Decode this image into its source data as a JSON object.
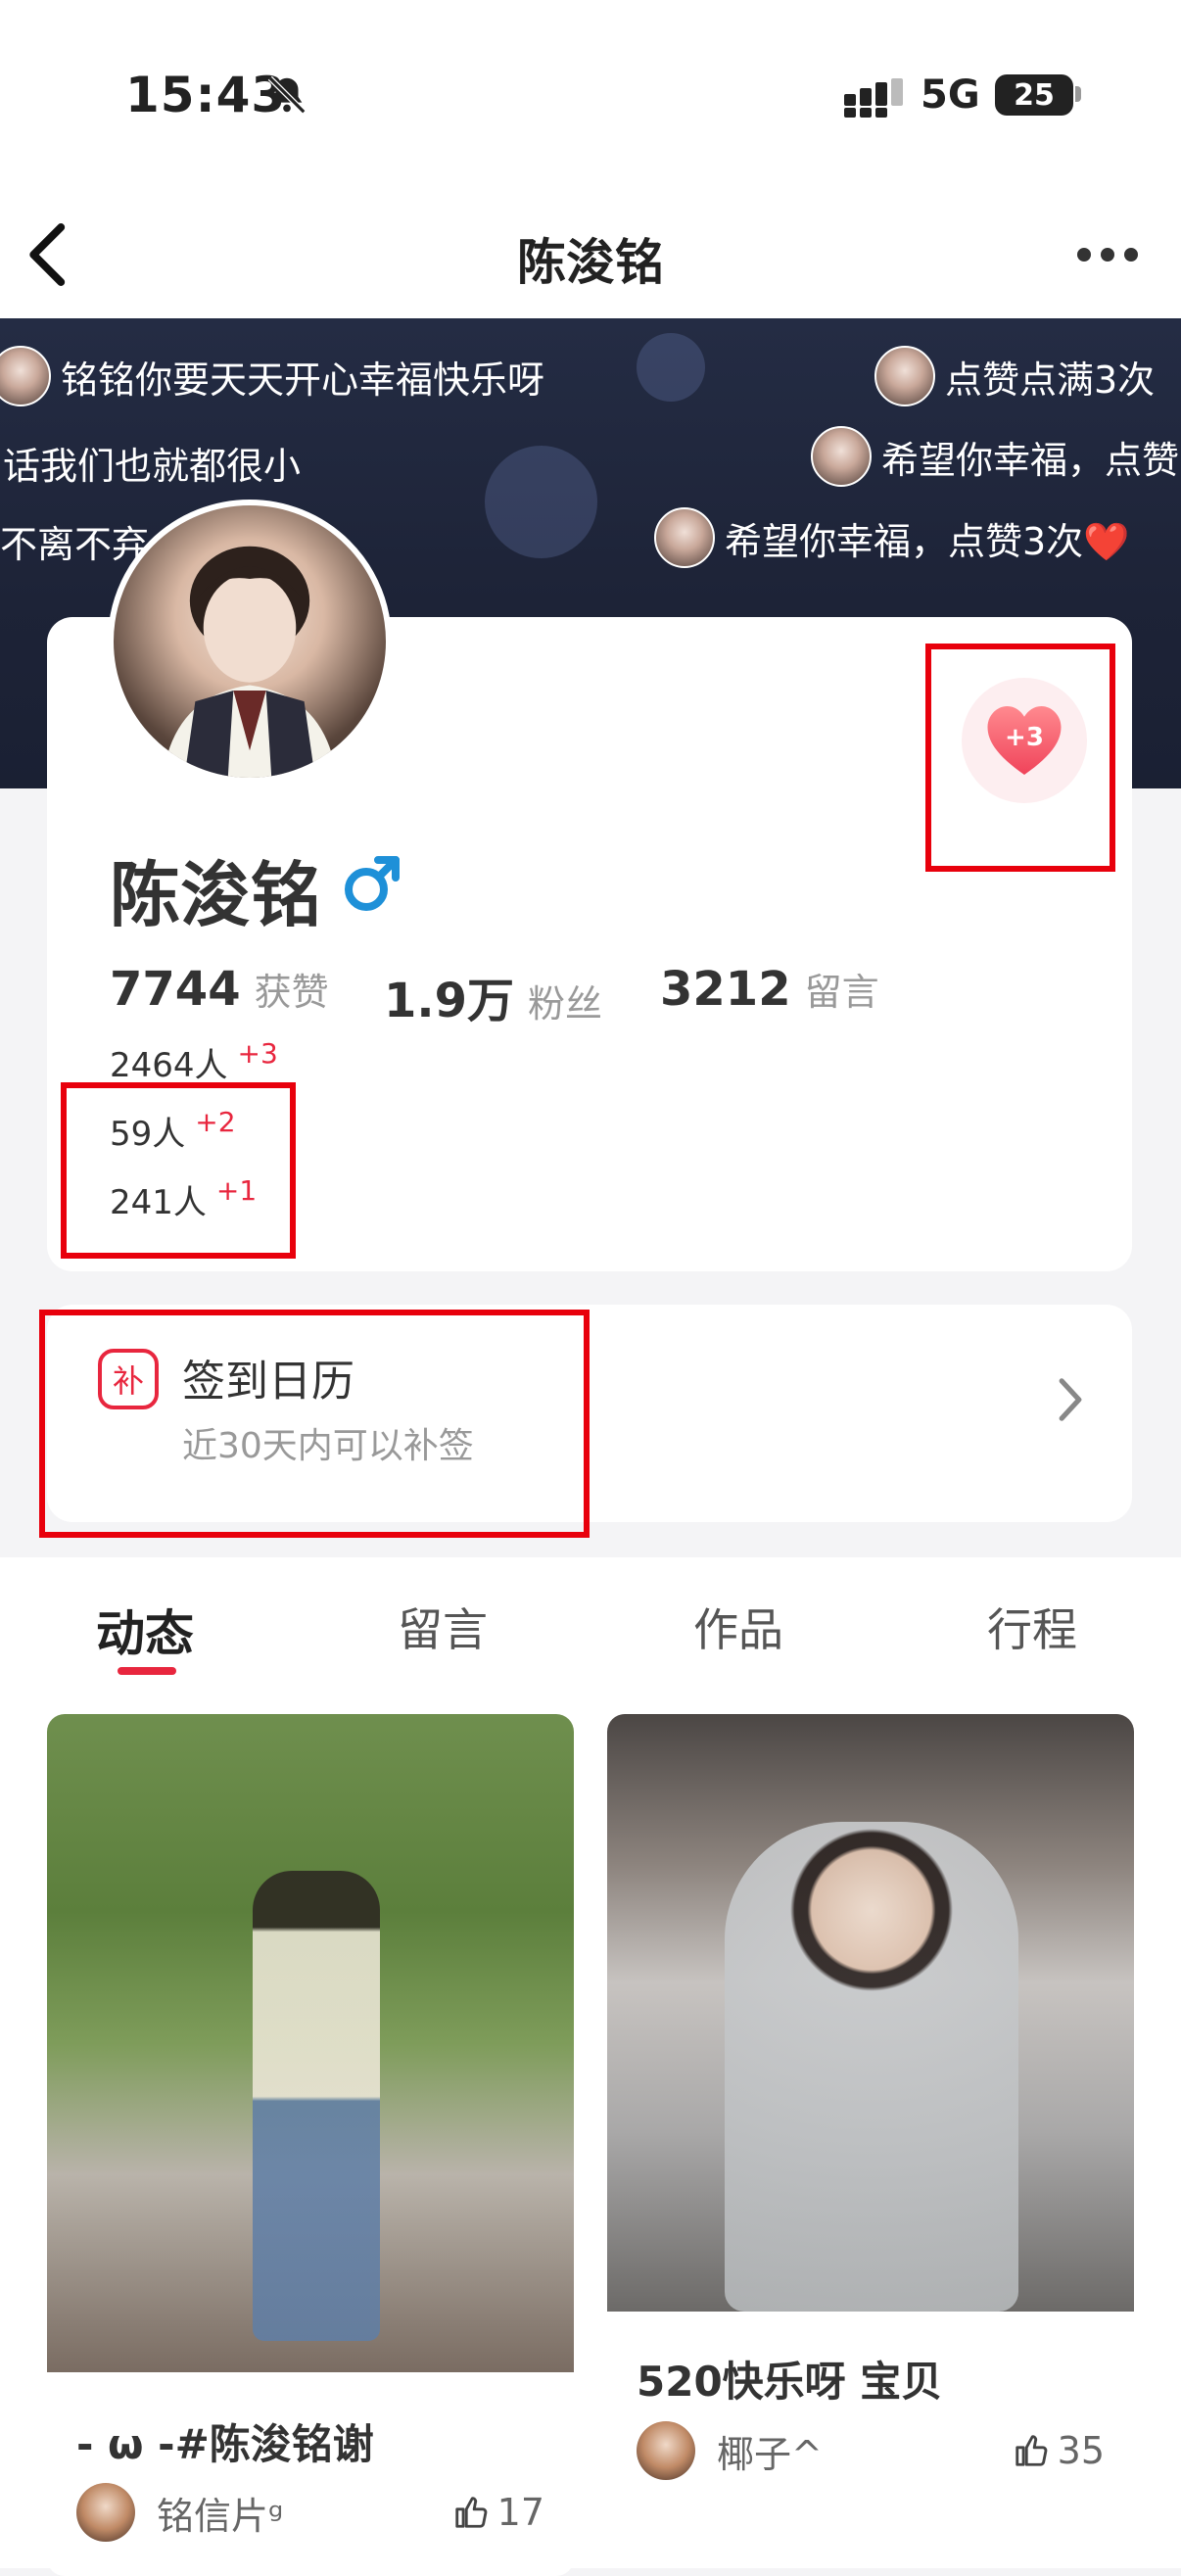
{
  "status": {
    "time": "15:43",
    "network": "5G",
    "battery": "25"
  },
  "nav": {
    "title": "陈浚铭"
  },
  "danmu": [
    "铭铭你要天天开心幸福快乐呀",
    "点赞点满3次",
    "话我们也就都很小",
    "希望你幸福，点赞",
    "不离不弃",
    "希望你幸福，点赞3次❤️"
  ],
  "profile": {
    "name": "陈浚铭",
    "like_plus": "+3",
    "stats": [
      {
        "value": "7744",
        "label": "获赞"
      },
      {
        "value": "1.9万",
        "label": "粉丝"
      },
      {
        "value": "3212",
        "label": "留言"
      }
    ],
    "counts": [
      {
        "text": "2464人",
        "inc": "+3"
      },
      {
        "text": "59人",
        "inc": "+2"
      },
      {
        "text": "241人",
        "inc": "+1"
      }
    ]
  },
  "sign": {
    "icon_char": "补",
    "title": "签到日历",
    "subtitle": "近30天内可以补签"
  },
  "tabs": [
    "动态",
    "留言",
    "作品",
    "行程"
  ],
  "posts": [
    {
      "title": "- ω -#陈浚铭谢",
      "user": "铭信片ᵍ",
      "likes": "17"
    },
    {
      "title": "520快乐呀 宝贝",
      "user": "椰子^",
      "likes": "35"
    }
  ],
  "colors": {
    "accent": "#e8263e",
    "highlight_box": "#e8000c",
    "gender": "#1e90d8"
  }
}
